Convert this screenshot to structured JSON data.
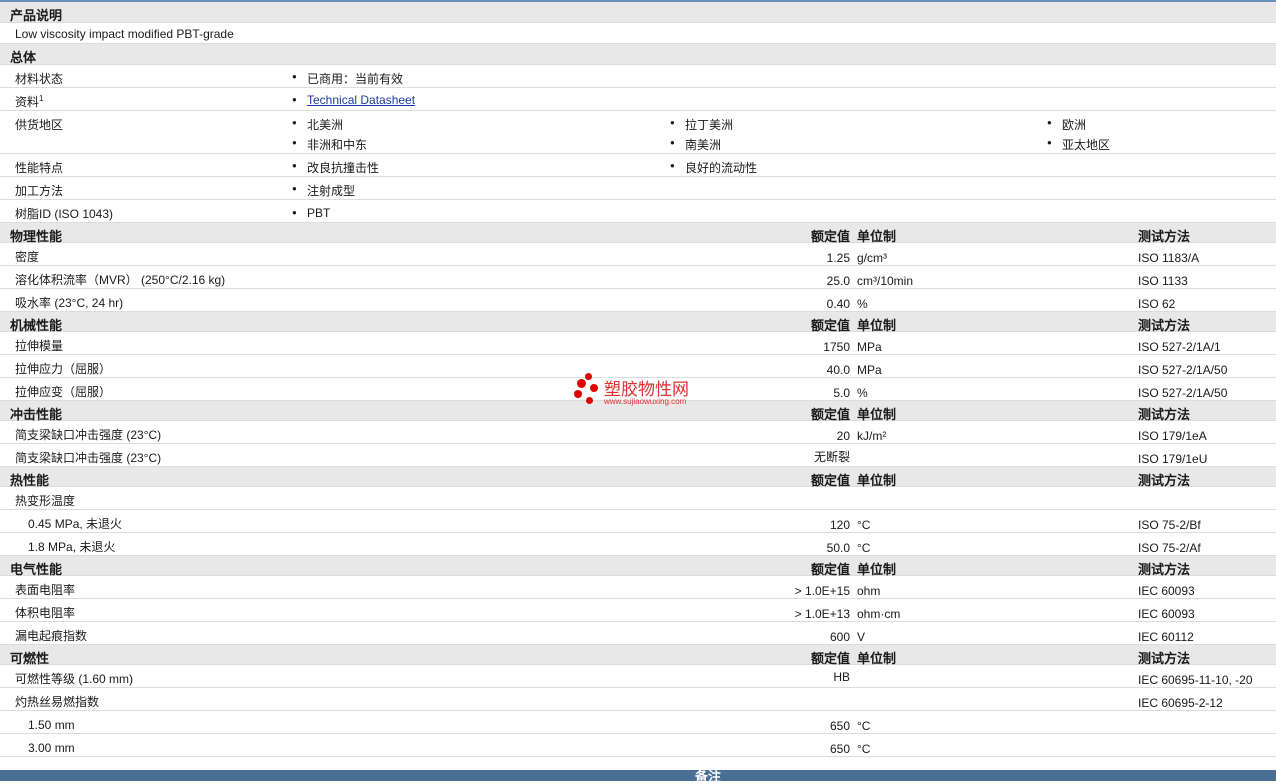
{
  "sections": {
    "desc": "产品说明",
    "general": "总体",
    "physical": "物理性能",
    "mechanical": "机械性能",
    "impact": "冲击性能",
    "thermal": "热性能",
    "electrical": "电气性能",
    "flammability": "可燃性",
    "notes": "备注"
  },
  "headers": {
    "value": "额定值",
    "unit": "单位制",
    "method": "测试方法"
  },
  "description": "Low viscosity impact modified PBT-grade",
  "general": {
    "status_label": "材料状态",
    "status_value": "已商用：当前有效",
    "docs_label": "资料",
    "docs_sup": "1",
    "docs_link": "Technical Datasheet",
    "regions_label": "供货地区",
    "regions": [
      "北美洲",
      "拉丁美洲",
      "欧洲",
      "非洲和中东",
      "南美洲",
      "亚太地区"
    ],
    "features_label": "性能特点",
    "features": [
      "改良抗撞击性",
      "良好的流动性"
    ],
    "processing_label": "加工方法",
    "processing": "注射成型",
    "resin_label": "树脂ID (ISO 1043)",
    "resin": "PBT"
  },
  "physical": [
    {
      "name": "密度",
      "value": "1.25",
      "unit": "g/cm³",
      "method": "ISO 1183/A"
    },
    {
      "name": "溶化体积流率（MVR） (250°C/2.16 kg)",
      "value": "25.0",
      "unit": "cm³/10min",
      "method": "ISO 1133"
    },
    {
      "name": "吸水率 (23°C, 24 hr)",
      "value": "0.40",
      "unit": "%",
      "method": "ISO 62"
    }
  ],
  "mechanical": [
    {
      "name": "拉伸模量",
      "value": "1750",
      "unit": "MPa",
      "method": "ISO 527-2/1A/1"
    },
    {
      "name": "拉伸应力（屈服）",
      "value": "40.0",
      "unit": "MPa",
      "method": "ISO 527-2/1A/50"
    },
    {
      "name": "拉伸应变（屈服）",
      "value": "5.0",
      "unit": "%",
      "method": "ISO 527-2/1A/50"
    }
  ],
  "impact": [
    {
      "name": "简支梁缺口冲击强度 (23°C)",
      "value": "20",
      "unit": "kJ/m²",
      "method": "ISO 179/1eA"
    },
    {
      "name": "简支梁缺口冲击强度 (23°C)",
      "value": "无断裂",
      "unit": "",
      "method": "ISO 179/1eU"
    }
  ],
  "thermal": {
    "hdt_label": "热变形温度",
    "rows": [
      {
        "name": "0.45 MPa, 未退火",
        "value": "120",
        "unit": "°C",
        "method": "ISO 75-2/Bf"
      },
      {
        "name": "1.8 MPa, 未退火",
        "value": "50.0",
        "unit": "°C",
        "method": "ISO 75-2/Af"
      }
    ]
  },
  "electrical": [
    {
      "name": "表面电阻率",
      "value": "> 1.0E+15",
      "unit": "ohm",
      "method": "IEC 60093"
    },
    {
      "name": "体积电阻率",
      "value": "> 1.0E+13",
      "unit": "ohm·cm",
      "method": "IEC 60093"
    },
    {
      "name": "漏电起痕指数",
      "value": "600",
      "unit": "V",
      "method": "IEC 60112"
    }
  ],
  "flammability": {
    "rating": {
      "name": "可燃性等级 (1.60 mm)",
      "value": "HB",
      "unit": "",
      "method": "IEC 60695-11-10, -20"
    },
    "gwfi_label": "灼热丝易燃指数",
    "gwfi_method": "IEC 60695-2-12",
    "rows": [
      {
        "name": "1.50 mm",
        "value": "650",
        "unit": "°C"
      },
      {
        "name": "3.00 mm",
        "value": "650",
        "unit": "°C"
      }
    ]
  },
  "watermark": {
    "text": "塑胶物性网",
    "url": "www.sujiaowuxing.com",
    "color": "#e00000"
  },
  "colors": {
    "section_bg": "#e8e8e8",
    "footer_bg": "#4a6f97",
    "link": "#1a3aa0"
  }
}
